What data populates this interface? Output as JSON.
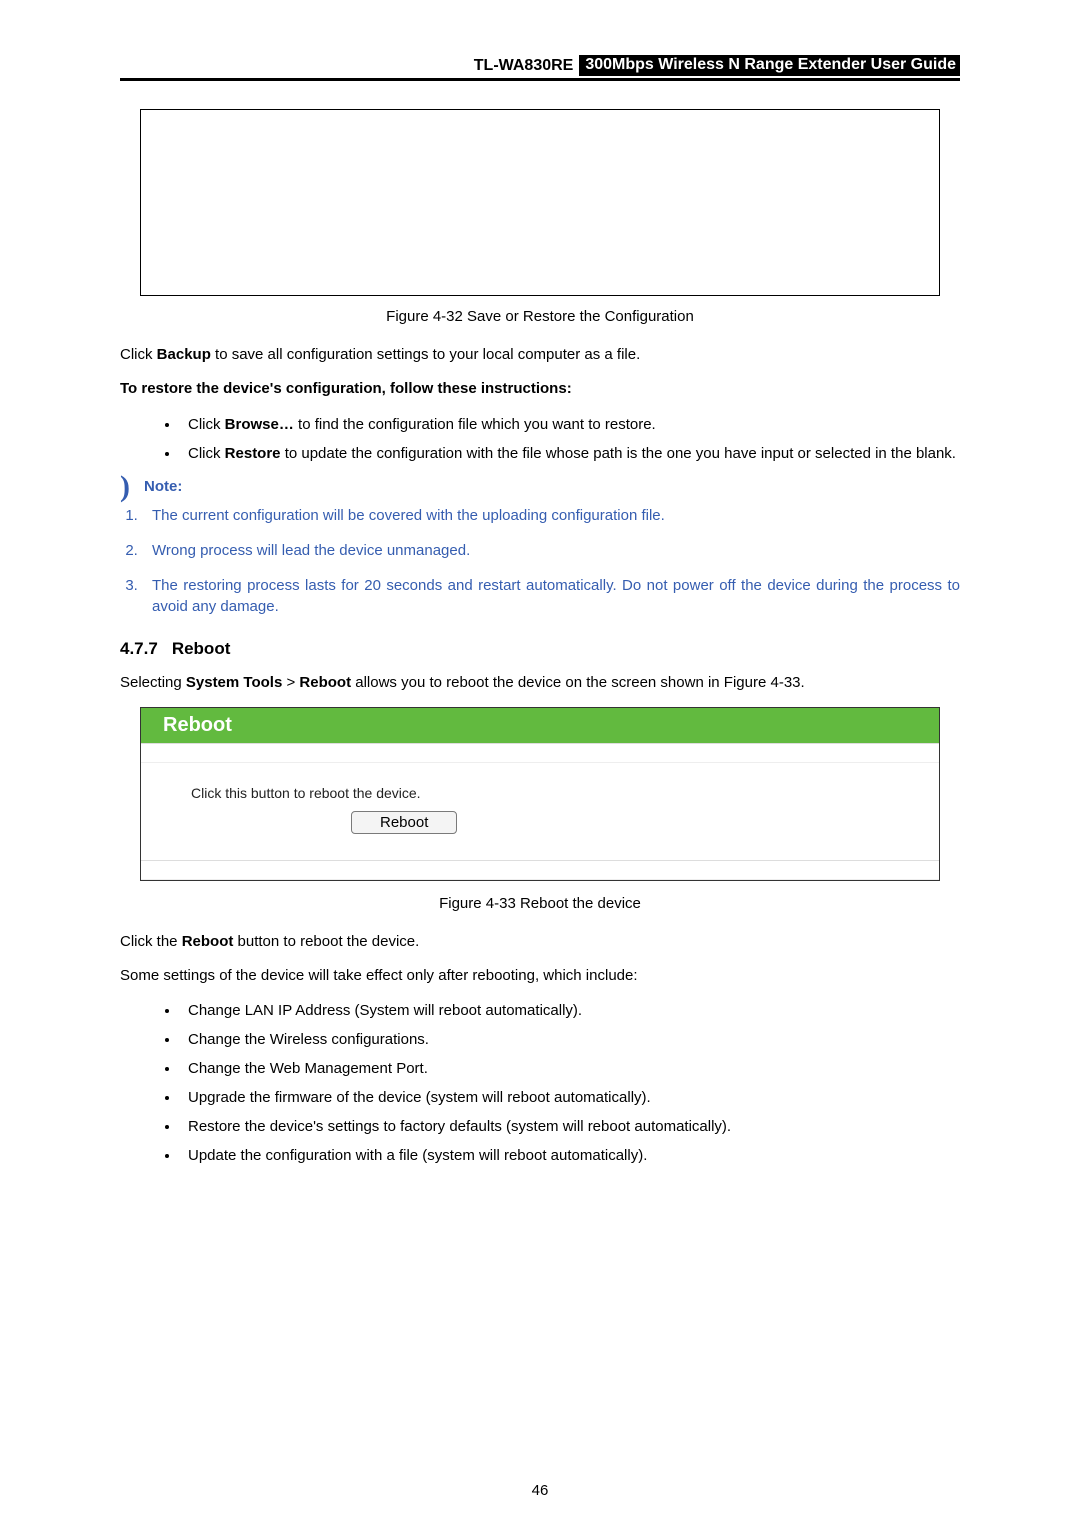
{
  "header": {
    "model": "TL-WA830RE",
    "title": "300Mbps Wireless N Range Extender User Guide"
  },
  "figure_top": {
    "caption": "Figure 4-32 Save or Restore the Configuration"
  },
  "intro_backup": {
    "prefix": "Click ",
    "bold": "Backup",
    "suffix": " to save all configuration settings to your local computer as a file."
  },
  "restore_heading": "To restore the device's configuration, follow these instructions:",
  "restore_items": {
    "browse_prefix": "Click ",
    "browse_bold": "Browse…",
    "browse_suffix": " to find the configuration file which you want to restore.",
    "restore_prefix": "Click ",
    "restore_bold": "Restore",
    "restore_suffix": " to update the configuration with the file whose path is the one you have input or selected in the blank."
  },
  "note_label": "Note:",
  "note_items": [
    "The current configuration will be covered with the uploading configuration file.",
    "Wrong process will lead the device unmanaged.",
    "The restoring process lasts for 20 seconds and restart automatically. Do not power off the device during the process to avoid any damage."
  ],
  "section": {
    "num": "4.7.7",
    "title": "Reboot"
  },
  "section_intro": {
    "prefix": "Selecting ",
    "b1": "System Tools",
    "sep": " > ",
    "b2": "Reboot",
    "suffix": " allows you to reboot the device on the screen shown in Figure 4-33."
  },
  "screenshot": {
    "title": "Reboot",
    "body_text": "Click this button to reboot the device.",
    "button": "Reboot"
  },
  "figure_bottom": {
    "caption": "Figure 4-33 Reboot the device"
  },
  "after_fig": {
    "prefix": "Click the ",
    "bold": "Reboot",
    "suffix": " button to reboot the device."
  },
  "effect_intro": "Some settings of the device will take effect only after rebooting, which include:",
  "effect_items": [
    "Change LAN IP Address (System will reboot automatically).",
    "Change the Wireless configurations.",
    "Change the Web Management Port.",
    "Upgrade the firmware of the device (system will reboot automatically).",
    "Restore the device's settings to factory defaults (system will reboot automatically).",
    "Update the configuration with a file (system will reboot automatically)."
  ],
  "page_number": "46"
}
